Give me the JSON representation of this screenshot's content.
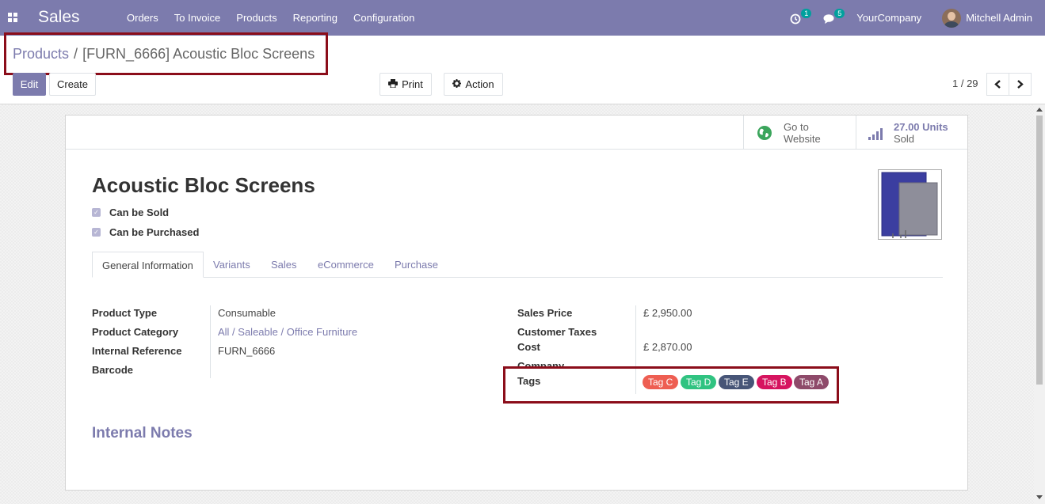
{
  "navbar": {
    "app_name": "Sales",
    "menu": [
      "Orders",
      "To Invoice",
      "Products",
      "Reporting",
      "Configuration"
    ],
    "activity_count": "1",
    "messages_count": "5",
    "company": "YourCompany",
    "user": "Mitchell Admin",
    "bg_color": "#7c7bad"
  },
  "breadcrumb": {
    "parent": "Products",
    "separator": "/",
    "current": "[FURN_6666] Acoustic Bloc Screens"
  },
  "toolbar": {
    "edit_label": "Edit",
    "create_label": "Create",
    "print_label": "Print",
    "action_label": "Action",
    "pager": "1 / 29"
  },
  "smart_buttons": {
    "website": {
      "line1": "Go to",
      "line2": "Website"
    },
    "sold": {
      "value": "27.00 Units",
      "label": "Sold"
    }
  },
  "product": {
    "name": "Acoustic Bloc Screens",
    "can_be_sold": "Can be Sold",
    "can_be_purchased": "Can be Purchased"
  },
  "tabs": [
    "General Information",
    "Variants",
    "Sales",
    "eCommerce",
    "Purchase"
  ],
  "general": {
    "left": [
      {
        "label": "Product Type",
        "value": "Consumable"
      },
      {
        "label": "Product Category",
        "value": "All / Saleable / Office Furniture"
      },
      {
        "label": "Internal Reference",
        "value": "FURN_6666"
      },
      {
        "label": "Barcode",
        "value": ""
      }
    ],
    "right": [
      {
        "label": "Sales Price",
        "value": "£ 2,950.00"
      },
      {
        "label": "Customer Taxes",
        "value": ""
      },
      {
        "label": "Cost",
        "value": "£ 2,870.00"
      },
      {
        "label": "Company",
        "value": ""
      },
      {
        "label": "Tags",
        "value": ""
      }
    ],
    "tags": [
      {
        "name": "Tag C",
        "color": "#ee5e52"
      },
      {
        "name": "Tag D",
        "color": "#30c381"
      },
      {
        "name": "Tag E",
        "color": "#475577"
      },
      {
        "name": "Tag B",
        "color": "#d6145f"
      },
      {
        "name": "Tag A",
        "color": "#8e4a6a"
      }
    ]
  },
  "notes": {
    "title": "Internal Notes"
  },
  "annotation_color": "#8b0d1a"
}
